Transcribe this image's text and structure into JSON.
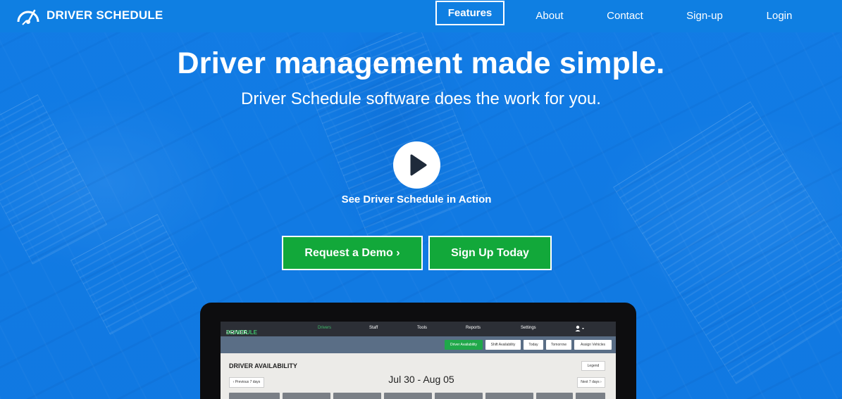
{
  "nav": {
    "brand": "DRIVER SCHEDULE",
    "items": [
      {
        "label": "Features",
        "active": true
      },
      {
        "label": "About",
        "active": false
      },
      {
        "label": "Contact",
        "active": false
      },
      {
        "label": "Sign-up",
        "active": false
      },
      {
        "label": "Login",
        "active": false
      }
    ]
  },
  "hero": {
    "headline": "Driver management made simple.",
    "subhead": "Driver Schedule software does the work for you.",
    "video_caption": "See Driver Schedule in Action",
    "demo_button": "Request a Demo ›",
    "signup_button": "Sign Up Today"
  },
  "app_preview": {
    "logo_part1": "DRIVER",
    "logo_part2": "SCHEDULE",
    "nav": [
      "Drivers",
      "Staff",
      "Tools",
      "Reports",
      "Settings"
    ],
    "user_icon": "user-icon",
    "toolbar": [
      "Driver Availability",
      "Shift Availability",
      "Today",
      "Tomorrow",
      "Assign Vehicles"
    ],
    "section_title": "DRIVER AVAILABILITY",
    "legend_label": "Legend",
    "date_range": "Jul 30 - Aug 05",
    "prev_label": "‹ Previous 7 days",
    "next_label": "Next 7 days ›"
  },
  "colors": {
    "primary_blue": "#0f7fe2",
    "cta_green": "#12a83a",
    "app_dark": "#2c2f36",
    "app_toolbar": "#5a6e86"
  }
}
